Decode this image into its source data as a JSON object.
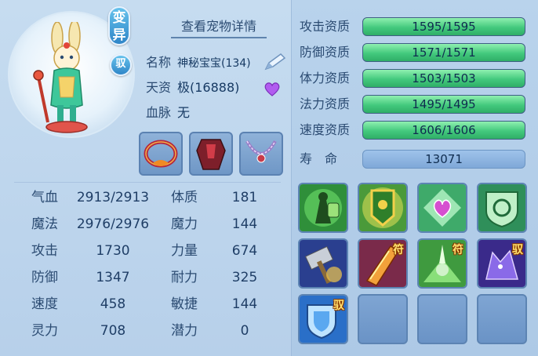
{
  "pet": {
    "mutant_badge": "变异",
    "tame_badge": "驭",
    "detail_link": "查看宠物详情",
    "name_label": "名称",
    "name_value": "神秘宝宝(134)",
    "aptitude_label": "天资",
    "aptitude_value": "极(16888)",
    "bloodline_label": "血脉",
    "bloodline_value": "无"
  },
  "equipment": [
    {
      "icon": "ring-collar-icon"
    },
    {
      "icon": "armor-icon"
    },
    {
      "icon": "necklace-icon"
    }
  ],
  "attributes": [
    {
      "label": "气血",
      "value": "2913/2913",
      "label2": "体质",
      "value2": "181"
    },
    {
      "label": "魔法",
      "value": "2976/2976",
      "label2": "魔力",
      "value2": "144"
    },
    {
      "label": "攻击",
      "value": "1730",
      "label2": "力量",
      "value2": "674"
    },
    {
      "label": "防御",
      "value": "1347",
      "label2": "耐力",
      "value2": "325"
    },
    {
      "label": "速度",
      "value": "458",
      "label2": "敏捷",
      "value2": "144"
    },
    {
      "label": "灵力",
      "value": "708",
      "label2": "潜力",
      "value2": "0"
    }
  ],
  "qualifications": [
    {
      "label": "攻击资质",
      "value": "1595/1595",
      "fill": 1.0
    },
    {
      "label": "防御资质",
      "value": "1571/1571",
      "fill": 1.0
    },
    {
      "label": "体力资质",
      "value": "1503/1503",
      "fill": 1.0
    },
    {
      "label": "法力资质",
      "value": "1495/1495",
      "fill": 1.0
    },
    {
      "label": "速度资质",
      "value": "1606/1606",
      "fill": 1.0
    }
  ],
  "lifespan": {
    "label": "寿　命",
    "value": "13071"
  },
  "skills": [
    {
      "icon": "warrior-shield-skill-icon",
      "badge": ""
    },
    {
      "icon": "emblem-banner-skill-icon",
      "badge": ""
    },
    {
      "icon": "heart-aura-skill-icon",
      "badge": ""
    },
    {
      "icon": "shield-emblem-skill-icon",
      "badge": ""
    },
    {
      "icon": "hammer-strike-skill-icon",
      "badge": ""
    },
    {
      "icon": "flame-blade-skill-icon",
      "badge": "符"
    },
    {
      "icon": "green-shatter-skill-icon",
      "badge": "符"
    },
    {
      "icon": "purple-wolf-skill-icon",
      "badge": "驭"
    },
    {
      "icon": "blue-shield-skill-icon",
      "badge": "驭"
    },
    {
      "icon": "empty-slot",
      "badge": ""
    },
    {
      "icon": "empty-slot",
      "badge": ""
    },
    {
      "icon": "empty-slot",
      "badge": ""
    }
  ]
}
